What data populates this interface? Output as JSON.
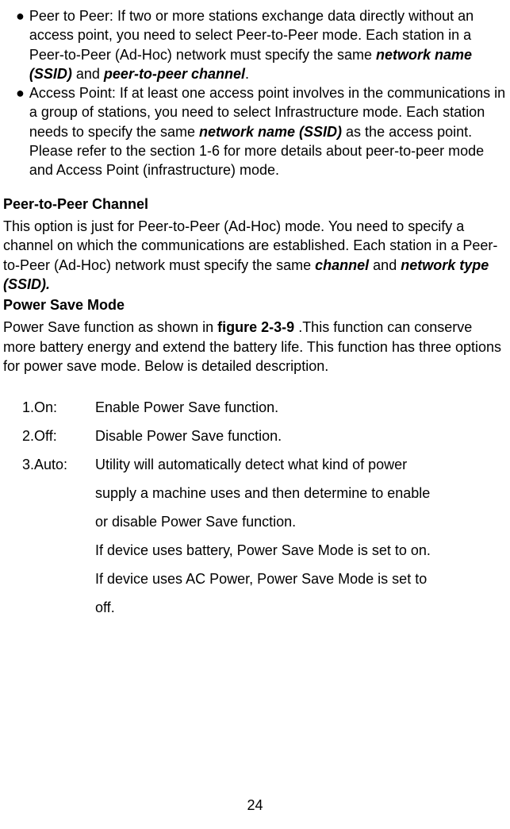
{
  "bullets": [
    {
      "prefix": "●",
      "label": "Peer to Peer:",
      "text1": " If two or more stations exchange data directly without an access point, you need to select Peer-to-Peer mode. Each station in a Peer-to-Peer (Ad-Hoc) network must specify the same ",
      "em1": "network name (SSID)",
      "mid1": " and ",
      "em2": "peer-to-peer channel",
      "end1": "."
    },
    {
      "prefix": "●",
      "label": "Access Point:",
      "text1": " If at least one access point involves in the communications in a group of stations, you need to select Infrastructure mode. Each station needs to specify the same ",
      "em1": "network name (SSID)",
      "mid1": " as the access point. Please refer to the section 1-6 for more details about peer-to-peer mode and Access Point (infrastructure) mode."
    }
  ],
  "section1": {
    "heading": "Peer-to-Peer Channel",
    "text1": "This option is just for Peer-to-Peer (Ad-Hoc) mode. You need to specify a channel on which the communications are established. Each station in a Peer-to-Peer (Ad-Hoc) network must specify the same ",
    "em1": "channel",
    "mid1": " and ",
    "em2": "network type (SSID)."
  },
  "section2": {
    "heading": "Power Save Mode",
    "text1": "Power Save function as shown in ",
    "bold1": "figure 2-3-9",
    "text2": " .This function can conserve more battery energy and extend the battery life. This function has three options for power save mode. Below is detailed description."
  },
  "options": [
    {
      "label": "1.On:",
      "lines": [
        "Enable Power Save function."
      ]
    },
    {
      "label": "2.Off:",
      "lines": [
        "Disable Power Save function."
      ]
    },
    {
      "label": "3.Auto:",
      "lines": [
        "Utility will automatically detect what kind of power",
        "supply a machine uses and then determine to enable",
        "or disable Power Save function.",
        "If device uses battery, Power Save Mode is set to on.",
        "If device uses AC Power, Power Save Mode is set to",
        "off."
      ]
    }
  ],
  "pageNumber": "24"
}
